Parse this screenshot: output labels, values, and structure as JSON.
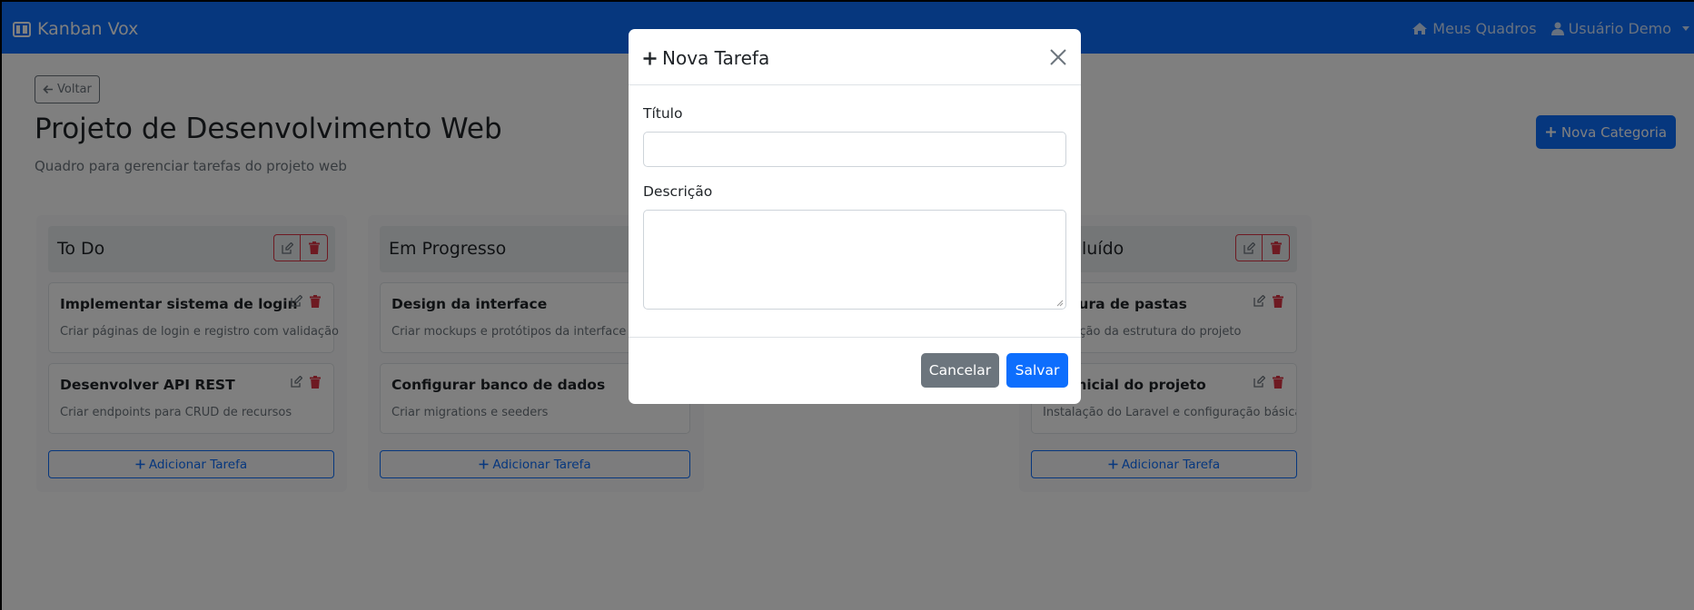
{
  "navbar": {
    "brand": "Kanban Vox",
    "meus_quadros": "Meus Quadros",
    "user": "Usuário Demo"
  },
  "board": {
    "back_label": "Voltar",
    "title": "Projeto de Desenvolvimento Web",
    "description": "Quadro para gerenciar tarefas do projeto web",
    "new_category_label": "Nova Categoria"
  },
  "columns": [
    {
      "title": "To Do",
      "tasks": [
        {
          "title": "Implementar sistema de login",
          "description": "Criar páginas de login e registro com validação"
        },
        {
          "title": "Desenvolver API REST",
          "description": "Criar endpoints para CRUD de recursos"
        }
      ],
      "add_label": "Adicionar Tarefa"
    },
    {
      "title": "Em Progresso",
      "tasks": [
        {
          "title": "Design da interface",
          "description": "Criar mockups e protótipos da interface do"
        },
        {
          "title": "Configurar banco de dados",
          "description": "Criar migrations e seeders"
        }
      ],
      "add_label": "Adicionar Tarefa"
    },
    {
      "title": "luído",
      "tasks": [
        {
          "title": "tura de pastas",
          "description": "ização da estrutura do projeto"
        },
        {
          "title": "inicial do projeto",
          "description": "Instalação do Laravel e configuração básica"
        }
      ],
      "add_label": "Adicionar Tarefa"
    }
  ],
  "modal": {
    "title": "Nova Tarefa",
    "title_label": "Título",
    "title_value": "",
    "description_label": "Descrição",
    "description_value": "",
    "cancel_label": "Cancelar",
    "save_label": "Salvar"
  },
  "colors": {
    "primary": "#0d6efd",
    "secondary": "#6c757d",
    "danger": "#dc3545"
  }
}
